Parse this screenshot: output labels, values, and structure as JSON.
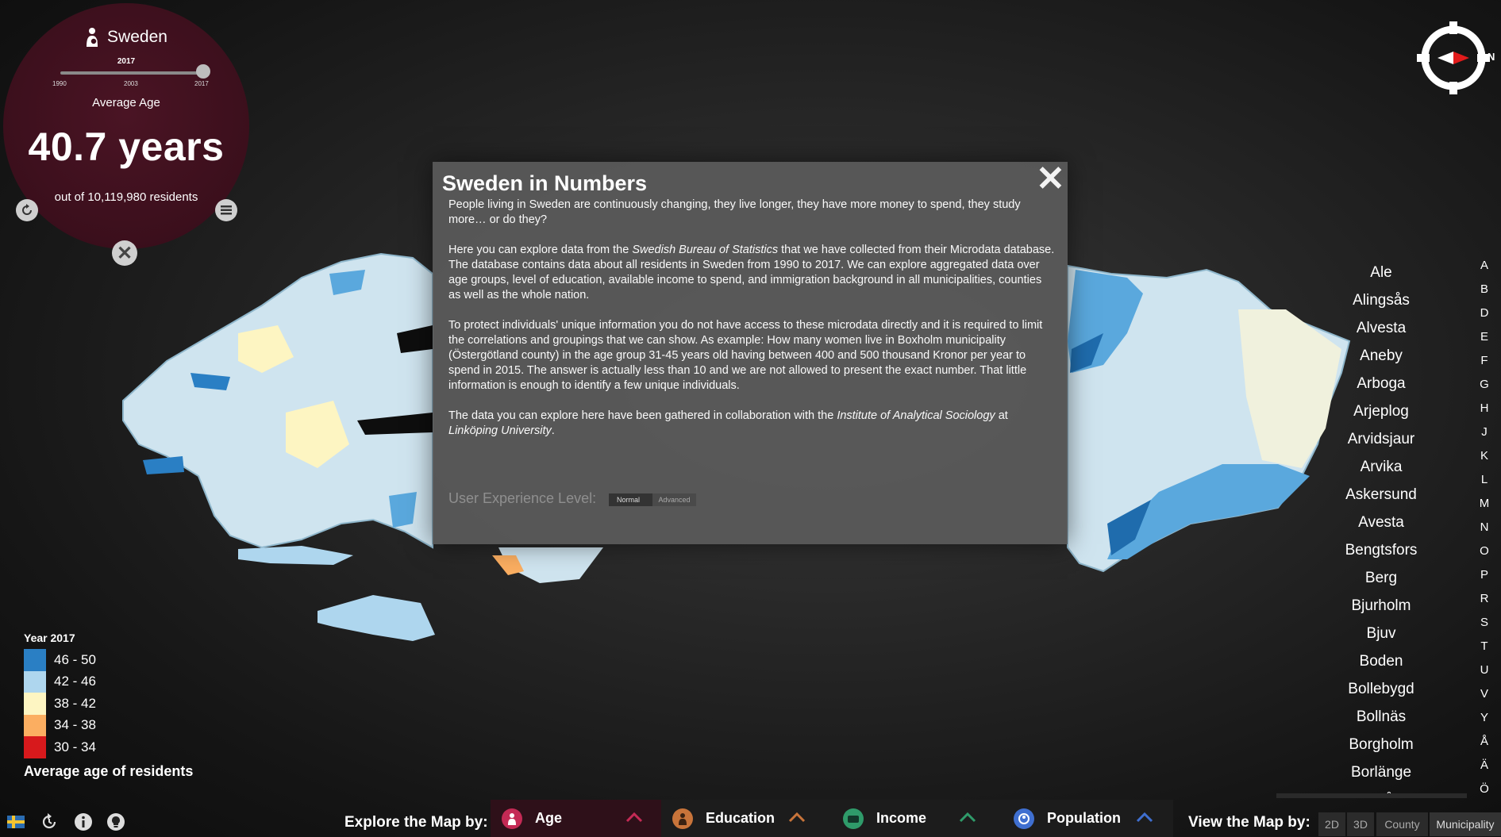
{
  "stats": {
    "region": "Sweden",
    "year_current": "2017",
    "year_ticks": [
      "1990",
      "2003",
      "2017"
    ],
    "year_progress": 1.0,
    "metric_label": "Average Age",
    "metric_value": "40.7 years",
    "residents": "out of 10,119,980 residents"
  },
  "compass": {
    "north_label": "N"
  },
  "dialog": {
    "title": "Sweden in Numbers",
    "p1": "People living in Sweden are continuously changing, they live longer, they have more money to spend, they study more… or do they?",
    "p2_a": "Here you can explore data from the ",
    "p2_em": "Swedish Bureau of Statistics",
    "p2_b": " that we have collected from their Microdata database. The database contains data about all residents in Sweden from 1990 to 2017. We can explore aggregated data over age groups, level of education, available income to spend, and immigration background in all municipalities, counties as well as the whole nation.",
    "p3": "To protect individuals' unique information you do not have access to these microdata directly and it is required to limit the correlations and groupings that we can show. As example: How many women live in Boxholm municipality (Östergötland county) in the age group 31-45 years old having between 400 and 500 thousand Kronor per year to spend in 2015. The answer is actually less than 10 and we are not allowed to present the exact number. That little information is enough to identify a few unique individuals.",
    "p4_a": "The data you can explore here have been gathered in collaboration with the ",
    "p4_em1": "Institute of Analytical Sociology",
    "p4_b": " at ",
    "p4_em2": "Linköping University",
    "p4_c": ".",
    "ux_label": "User Experience Level:",
    "ux_normal": "Normal",
    "ux_advanced": "Advanced"
  },
  "municipalities": [
    "Ale",
    "Alingsås",
    "Alvesta",
    "Aneby",
    "Arboga",
    "Arjeplog",
    "Arvidsjaur",
    "Arvika",
    "Askersund",
    "Avesta",
    "Bengtsfors",
    "Berg",
    "Bjurholm",
    "Bjuv",
    "Boden",
    "Bollebygd",
    "Bollnäs",
    "Borgholm",
    "Borlänge",
    "Borås"
  ],
  "letters": [
    "A",
    "B",
    "D",
    "E",
    "F",
    "G",
    "H",
    "J",
    "K",
    "L",
    "M",
    "N",
    "O",
    "P",
    "R",
    "S",
    "T",
    "U",
    "V",
    "Y",
    "Å",
    "Ä",
    "Ö"
  ],
  "legend": {
    "year": "Year 2017",
    "items": [
      {
        "label": "46 - 50",
        "color": "#2a7fc4"
      },
      {
        "label": "42 - 46",
        "color": "#aed6ee"
      },
      {
        "label": "38 - 42",
        "color": "#fdf5c2"
      },
      {
        "label": "34 - 38",
        "color": "#fbae61"
      },
      {
        "label": "30 - 34",
        "color": "#d7191c"
      }
    ],
    "caption": "Average age of residents"
  },
  "bottom": {
    "explore_label": "Explore the Map by:",
    "categories": [
      {
        "label": "Age",
        "color": "#c42a55"
      },
      {
        "label": "Education",
        "color": "#c8743a"
      },
      {
        "label": "Income",
        "color": "#2f9b6a"
      },
      {
        "label": "Population",
        "color": "#3f6fd0"
      }
    ],
    "view_label": "View the Map by:",
    "views": [
      "2D",
      "3D",
      "County",
      "Municipality"
    ]
  }
}
